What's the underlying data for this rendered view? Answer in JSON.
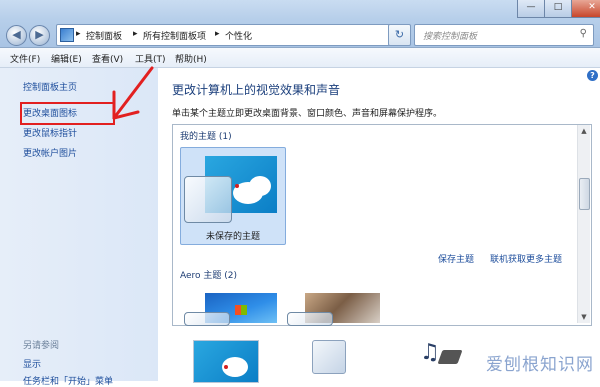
{
  "address_bar": {
    "crumbs": [
      "控制面板",
      "所有控制面板项",
      "个性化"
    ]
  },
  "search": {
    "placeholder": "搜索控制面板"
  },
  "menu": [
    "文件(F)",
    "编辑(E)",
    "查看(V)",
    "工具(T)",
    "帮助(H)"
  ],
  "window_controls": {
    "minimize": "—",
    "maximize": "□",
    "close": "✕"
  },
  "left_pane": {
    "links": [
      "控制面板主页",
      "更改桌面图标",
      "更改鼠标指针",
      "更改帐户图片"
    ],
    "see_also_heading": "另请参阅",
    "see_also": [
      "显示",
      "任务栏和「开始」菜单"
    ]
  },
  "main": {
    "title": "更改计算机上的视觉效果和声音",
    "subtitle": "单击某个主题立即更改桌面背景、窗口颜色、声音和屏幕保护程序。",
    "my_themes": {
      "heading": "我的主题 (1)",
      "tiles": [
        {
          "label": "未保存的主题",
          "selected": true
        }
      ]
    },
    "save_theme_link": "保存主题",
    "get_more_link": "联机获取更多主题",
    "aero_themes": {
      "heading": "Aero 主题 (2)"
    }
  },
  "watermark": "爱刨根知识网",
  "colors": {
    "accent_link": "#1e4e9c",
    "annotation_red": "#e22020"
  }
}
